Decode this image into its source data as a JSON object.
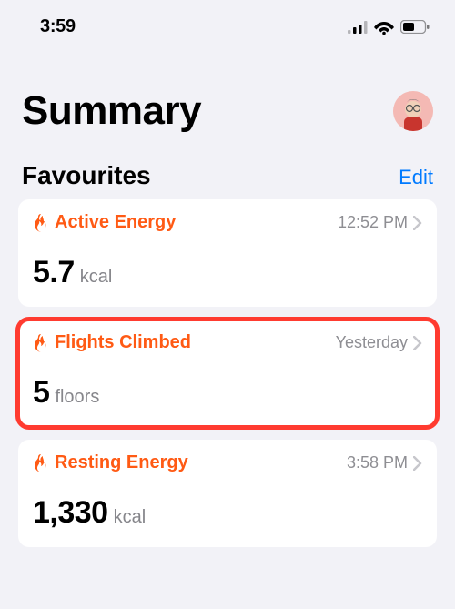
{
  "status": {
    "time": "3:59"
  },
  "header": {
    "title": "Summary"
  },
  "section": {
    "title": "Favourites",
    "edit": "Edit"
  },
  "cards": {
    "activeEnergy": {
      "label": "Active Energy",
      "time": "12:52 PM",
      "value": "5.7",
      "unit": "kcal"
    },
    "flightsClimbed": {
      "label": "Flights Climbed",
      "time": "Yesterday",
      "value": "5",
      "unit": "floors"
    },
    "restingEnergy": {
      "label": "Resting Energy",
      "time": "3:58 PM",
      "value": "1,330",
      "unit": "kcal"
    }
  }
}
